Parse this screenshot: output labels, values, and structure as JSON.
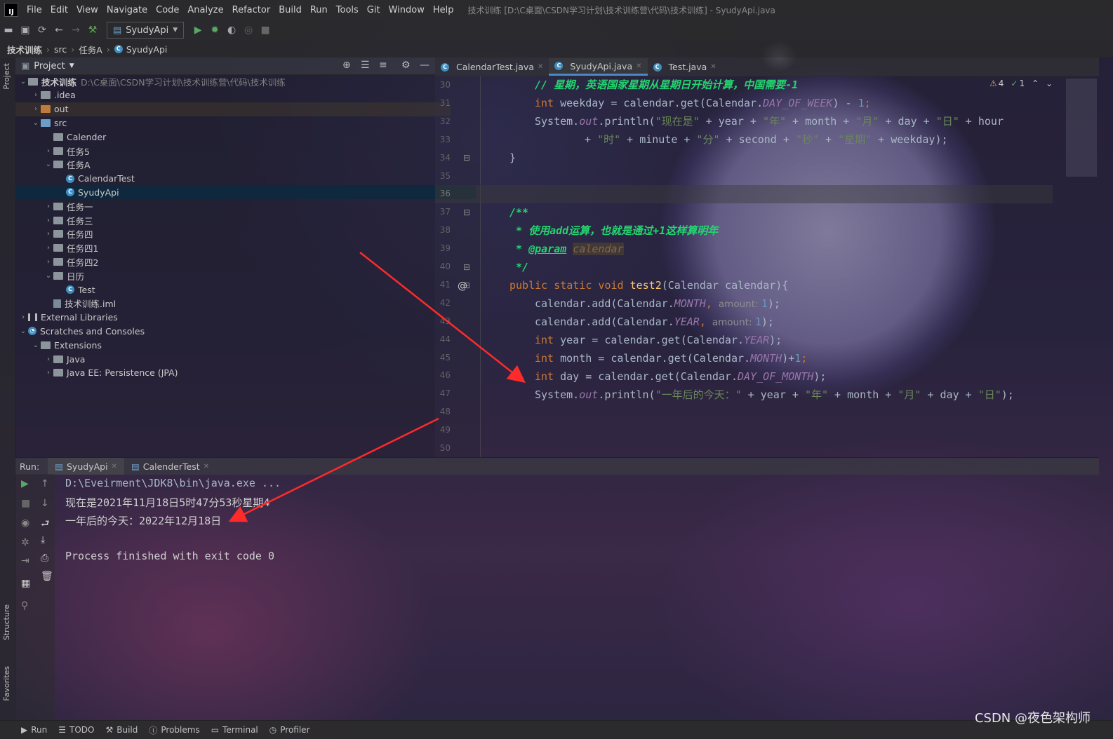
{
  "app": {
    "logo_text": "IJ",
    "window_title": "技术训练 [D:\\C桌面\\CSDN学习计划\\技术训练营\\代码\\技术训练] - SyudyApi.java"
  },
  "menu": [
    "File",
    "Edit",
    "View",
    "Navigate",
    "Code",
    "Analyze",
    "Refactor",
    "Build",
    "Run",
    "Tools",
    "Git",
    "Window",
    "Help"
  ],
  "toolbar": {
    "run_config": "SyudyApi"
  },
  "breadcrumb": [
    "技术训练",
    "src",
    "任务A",
    "SyudyApi"
  ],
  "side_tabs": {
    "project": "Project",
    "structure": "Structure",
    "favorites": "Favorites"
  },
  "project": {
    "title": "Project",
    "root_name": "技术训练",
    "root_path": "D:\\C桌面\\CSDN学习计划\\技术训练营\\代码\\技术训练",
    "items": [
      {
        "label": ".idea",
        "depth": 1,
        "arrow": "›",
        "icon": "folder"
      },
      {
        "label": "out",
        "depth": 1,
        "arrow": "›",
        "icon": "folder-orange"
      },
      {
        "label": "src",
        "depth": 1,
        "arrow": "⌄",
        "icon": "folder-blue"
      },
      {
        "label": "Calender",
        "depth": 2,
        "arrow": "",
        "icon": "folder"
      },
      {
        "label": "任务5",
        "depth": 2,
        "arrow": "›",
        "icon": "folder"
      },
      {
        "label": "任务A",
        "depth": 2,
        "arrow": "⌄",
        "icon": "folder"
      },
      {
        "label": "CalendarTest",
        "depth": 3,
        "arrow": "",
        "icon": "class"
      },
      {
        "label": "SyudyApi",
        "depth": 3,
        "arrow": "",
        "icon": "class",
        "selected": true
      },
      {
        "label": "任务一",
        "depth": 2,
        "arrow": "›",
        "icon": "folder"
      },
      {
        "label": "任务三",
        "depth": 2,
        "arrow": "›",
        "icon": "folder"
      },
      {
        "label": "任务四",
        "depth": 2,
        "arrow": "›",
        "icon": "folder"
      },
      {
        "label": "任务四1",
        "depth": 2,
        "arrow": "›",
        "icon": "folder"
      },
      {
        "label": "任务四2",
        "depth": 2,
        "arrow": "›",
        "icon": "folder"
      },
      {
        "label": "日历",
        "depth": 2,
        "arrow": "⌄",
        "icon": "folder"
      },
      {
        "label": "Test",
        "depth": 3,
        "arrow": "",
        "icon": "class"
      },
      {
        "label": "技术训练.iml",
        "depth": 2,
        "arrow": "",
        "icon": "iml"
      },
      {
        "label": "External Libraries",
        "depth": 0,
        "arrow": "›",
        "icon": "library"
      },
      {
        "label": "Scratches and Consoles",
        "depth": 0,
        "arrow": "⌄",
        "icon": "scratch"
      },
      {
        "label": "Extensions",
        "depth": 1,
        "arrow": "⌄",
        "icon": "folder"
      },
      {
        "label": "Java",
        "depth": 2,
        "arrow": "›",
        "icon": "folder"
      },
      {
        "label": "Java EE: Persistence (JPA)",
        "depth": 2,
        "arrow": "›",
        "icon": "folder"
      }
    ]
  },
  "editor_tabs": [
    {
      "label": "CalendarTest.java",
      "active": false
    },
    {
      "label": "SyudyApi.java",
      "active": true
    },
    {
      "label": "Test.java",
      "active": false
    }
  ],
  "inspections": {
    "warnings": "4",
    "ok": "1"
  },
  "line_numbers": [
    "30",
    "31",
    "32",
    "33",
    "34",
    "35",
    "36",
    "37",
    "38",
    "39",
    "40",
    "41",
    "42",
    "43",
    "44",
    "45",
    "46",
    "47",
    "48",
    "49",
    "50"
  ],
  "gutter_marks": {
    "override": "@"
  },
  "code": {
    "l30": "// 星期，英语国家星期从星期日开始计算，中国需要-1",
    "l31a": "int",
    "l31b": " weekday = calendar.get(Calendar.",
    "l31c": "DAY_OF_WEEK",
    "l31d": ") - ",
    "l31e": "1",
    "l31f": ";",
    "l32a": "System.",
    "l32b": "out",
    "l32c": ".println(",
    "l32d": "\"现在是\"",
    "l32e": " + year + ",
    "l32f": "\"年\"",
    "l32g": " + month + ",
    "l32h": "\"月\"",
    "l32i": " + day + ",
    "l32j": "\"日\"",
    "l32k": " + hour",
    "l33a": "+ ",
    "l33b": "\"时\"",
    "l33c": " + minute + ",
    "l33d": "\"分\"",
    "l33e": " + second + ",
    "l33f": "\"秒\"",
    "l33g": " + ",
    "l33h": "\"星期\"",
    "l33i": " + weekday);",
    "l34": "}",
    "l37": "/**",
    "l38": " * 使用add运算，也就是通过+1这样算明年",
    "l39a": " * ",
    "l39b": "@param",
    "l39c": " ",
    "l39d": "calendar",
    "l40": " */",
    "l41a": "public static void ",
    "l41b": "test2",
    "l41c": "(Calendar calendar){",
    "l42a": "calendar.add(Calendar.",
    "l42b": "MONTH",
    "l42c": ", ",
    "l42d": "amount: ",
    "l42e": "1",
    "l42f": ");",
    "l43a": "calendar.add(Calendar.",
    "l43b": "YEAR",
    "l43c": ", ",
    "l43d": "amount: ",
    "l43e": "1",
    "l43f": ");",
    "l44a": "int",
    "l44b": " year = calendar.get(Calendar.",
    "l44c": "YEAR",
    "l44d": ");",
    "l45a": "int",
    "l45b": " month = calendar.get(Calendar.",
    "l45c": "MONTH",
    "l45d": ")+",
    "l45e": "1",
    "l45f": ";",
    "l46a": "int",
    "l46b": " day = calendar.get(Calendar.",
    "l46c": "DAY_OF_MONTH",
    "l46d": ");",
    "l47a": "System.",
    "l47b": "out",
    "l47c": ".println(",
    "l47d": "\"一年后的今天：\"",
    "l47e": " + year + ",
    "l47f": "\"年\"",
    "l47g": " + month + ",
    "l47h": "\"月\"",
    "l47i": " + day + ",
    "l47j": "\"日\"",
    "l47k": ");"
  },
  "run": {
    "label": "Run:",
    "tabs": [
      {
        "label": "SyudyApi"
      },
      {
        "label": "CalenderTest"
      }
    ],
    "output": [
      "D:\\Eveirment\\JDK8\\bin\\java.exe ...",
      "现在是2021年11月18日5时47分53秒星期4",
      "一年后的今天：2022年12月18日",
      "",
      "Process finished with exit code 0"
    ]
  },
  "bottom_tabs": [
    "Run",
    "TODO",
    "Build",
    "Problems",
    "Terminal",
    "Profiler"
  ],
  "watermark": "CSDN @夜色架构师",
  "colors": {
    "keyword": "#cc7832",
    "string": "#6a8759",
    "comment": "#23d56f",
    "static_field": "#9876aa",
    "function": "#ffc66d",
    "arrow": "#ff2a2a"
  }
}
